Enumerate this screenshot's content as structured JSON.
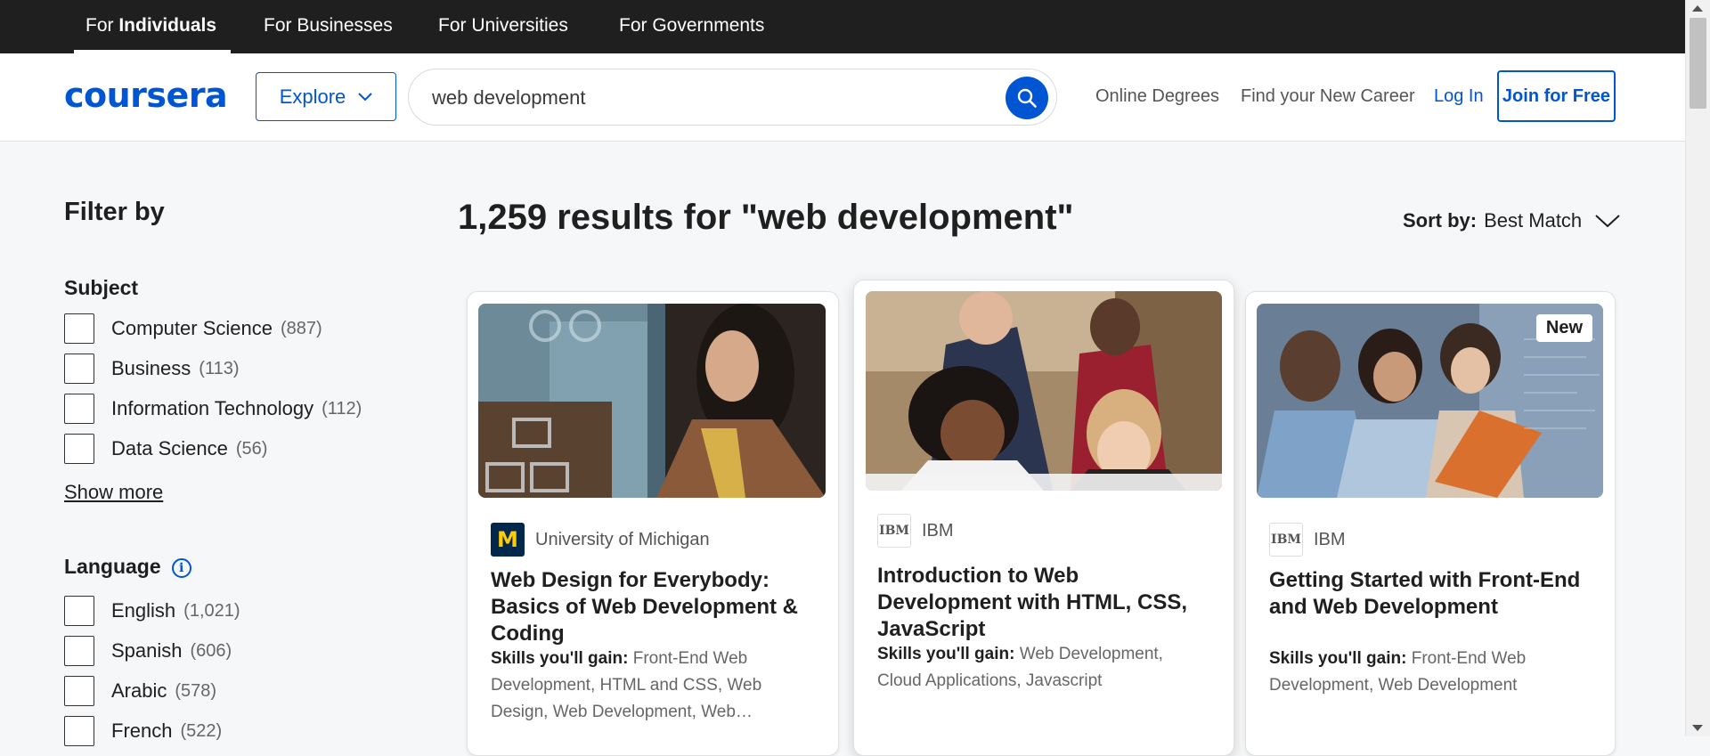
{
  "topnav": {
    "tabs": [
      {
        "prefix": "For ",
        "bold": "Individuals"
      },
      {
        "label": "For Businesses"
      },
      {
        "label": "For Universities"
      },
      {
        "label": "For Governments"
      }
    ]
  },
  "header": {
    "logo": "coursera",
    "explore_label": "Explore",
    "search_value": "web development",
    "links": [
      "Online Degrees",
      "Find your New Career"
    ],
    "login_label": "Log In",
    "join_label": "Join for Free"
  },
  "filters": {
    "title": "Filter by",
    "subject": {
      "title": "Subject",
      "options": [
        {
          "label": "Computer Science",
          "count": "(887)"
        },
        {
          "label": "Business",
          "count": "(113)"
        },
        {
          "label": "Information Technology",
          "count": "(112)"
        },
        {
          "label": "Data Science",
          "count": "(56)"
        }
      ],
      "show_more": "Show more"
    },
    "language": {
      "title": "Language",
      "info_icon": "i",
      "options": [
        {
          "label": "English",
          "count": "(1,021)"
        },
        {
          "label": "Spanish",
          "count": "(606)"
        },
        {
          "label": "Arabic",
          "count": "(578)"
        },
        {
          "label": "French",
          "count": "(522)"
        }
      ]
    }
  },
  "results": {
    "title": "1,259 results for \"web development\"",
    "sort_label": "Sort by:",
    "sort_value": "Best Match"
  },
  "cards": [
    {
      "partner": "University of Michigan",
      "partner_logo": "M",
      "title": "Web Design for Everybody: Basics of Web Development & Coding",
      "skills_label": "Skills you'll gain:",
      "skills": "Front-End Web Development, HTML and CSS, Web Design, Web Development, Web…",
      "badge": ""
    },
    {
      "partner": "IBM",
      "partner_logo": "IBM",
      "title": "Introduction to Web Development with HTML, CSS, JavaScript",
      "skills_label": "Skills you'll gain:",
      "skills": "Web Development, Cloud Applications, Javascript",
      "badge": ""
    },
    {
      "partner": "IBM",
      "partner_logo": "IBM",
      "title": "Getting Started with Front-End and Web Development",
      "skills_label": "Skills you'll gain:",
      "skills": "Front-End Web Development, Web Development",
      "badge": "New"
    }
  ],
  "colors": {
    "brand": "#0056d2",
    "topbar": "#1f1f1f",
    "page_bg": "#f5f7f8"
  }
}
